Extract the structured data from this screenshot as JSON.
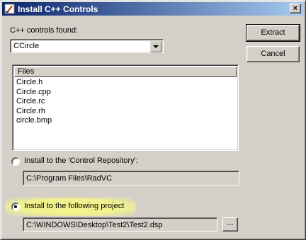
{
  "window": {
    "title": "Install C++ Controls",
    "close_glyph": "×"
  },
  "controls_found": {
    "label": "C++ controls found:",
    "selected": "CCircle"
  },
  "buttons": {
    "extract": "Extract",
    "cancel": "Cancel",
    "browse": "..."
  },
  "files": {
    "header": "Files",
    "items": [
      "Circle.h",
      "Circle.cpp",
      "Circle.rc",
      "Circle.rh",
      "circle.bmp"
    ]
  },
  "options": {
    "repository": {
      "label": "Install to the 'Control Repository':",
      "path": "C:\\Program Files\\RadVC",
      "checked": false
    },
    "project": {
      "label": "Install to the following project",
      "path": "C:\\WINDOWS\\Desktop\\Test2\\Test2.dsp",
      "checked": true
    }
  },
  "colors": {
    "title_start": "#0a246a",
    "title_end": "#a6caf0",
    "face": "#d4d0c8",
    "highlight": "#f2f28c"
  }
}
